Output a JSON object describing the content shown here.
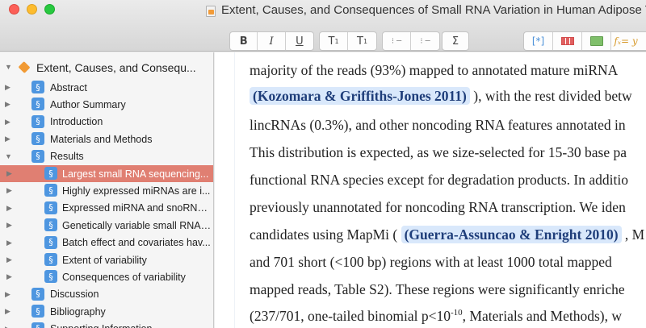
{
  "window": {
    "title": "Extent, Causes, and Consequences of Small RNA Variation in Human Adipose Tiss"
  },
  "toolbar": {
    "bold": "B",
    "italic": "I",
    "underline": "U",
    "superscript": "T",
    "superscript_mark": "1",
    "subscript": "T",
    "subscript_mark": "1",
    "bullets_glyph": "⁝ ─",
    "numbered_glyph": "⁝ ─",
    "sigma": "Σ",
    "citation_glyph": "[*]",
    "fx_glyph": "fₓ= y"
  },
  "sidebar": {
    "project": "Extent, Causes, and Consequ...",
    "section_glyph": "§",
    "items": [
      {
        "label": "Abstract"
      },
      {
        "label": "Author Summary"
      },
      {
        "label": "Introduction"
      },
      {
        "label": "Materials and Methods"
      },
      {
        "label": "Results"
      },
      {
        "label": "Largest small RNA sequencing..."
      },
      {
        "label": "Highly expressed miRNAs are i..."
      },
      {
        "label": "Expressed miRNA and snoRNA..."
      },
      {
        "label": "Genetically variable small RNAs..."
      },
      {
        "label": "Batch effect and covariates hav..."
      },
      {
        "label": "Extent of variability"
      },
      {
        "label": "Consequences of variability"
      },
      {
        "label": "Discussion"
      },
      {
        "label": "Bibliography"
      },
      {
        "label": "Supporting Information"
      }
    ]
  },
  "editor": {
    "l1": "majority of the reads (93%) mapped to annotated mature miRNA",
    "l2_cite": "(Kozomara & Griffiths-Jones 2011)",
    "l2_rest": " ), with the rest divided betw",
    "l3": "lincRNAs (0.3%), and other noncoding RNA features annotated in",
    "l4": "This distribution is expected, as we size-selected for 15-30 base pa",
    "l5": "functional RNA species except for degradation products. In additio",
    "l6": "previously unannotated for noncoding RNA transcription. We iden",
    "l7_pre": "candidates using MapMi ( ",
    "l7_cite": "(Guerra-Assuncao & Enright 2010)",
    "l7_post": " , M",
    "l8": "and 701 short (<100 bp) regions with at least 1000 total mapped",
    "l9": "mapped reads, Table S2). These regions were significantly enriche",
    "l10_pre": "(237/701, one-tailed binomial p<10",
    "l10_exp": "-10",
    "l10_post": ", Materials and Methods), w"
  },
  "colors": {
    "selection": "#e07f72",
    "citation_bg": "#d9e8fb",
    "section_icon": "#4e96e0"
  }
}
